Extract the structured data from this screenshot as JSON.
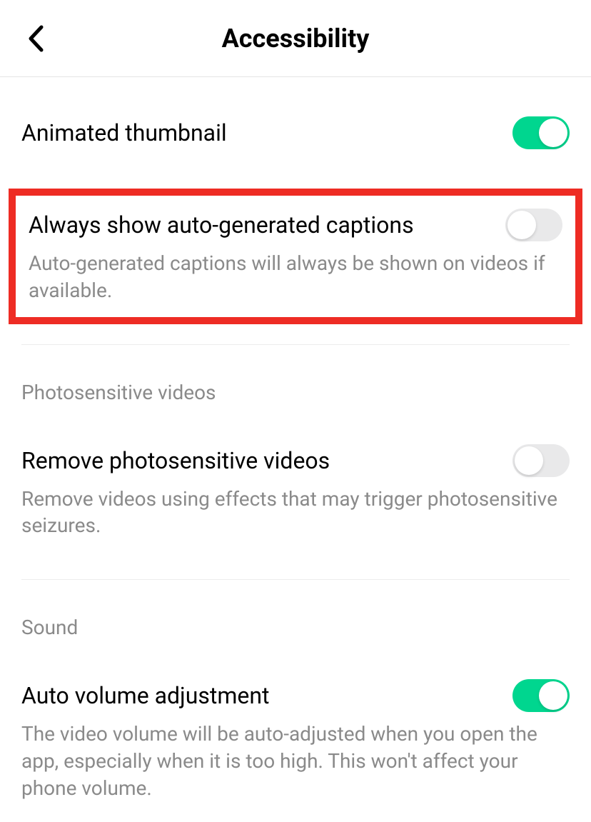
{
  "header": {
    "title": "Accessibility"
  },
  "settings": {
    "animated_thumbnail": {
      "title": "Animated thumbnail",
      "enabled": true
    },
    "auto_captions": {
      "title": "Always show auto-generated captions",
      "description": "Auto-generated captions will always be shown on videos if available.",
      "enabled": false
    },
    "photosensitive": {
      "section_label": "Photosensitive videos",
      "title": "Remove photosensitive videos",
      "description": "Remove videos using effects that may trigger photosensitive seizures.",
      "enabled": false
    },
    "sound": {
      "section_label": "Sound",
      "title": "Auto volume adjustment",
      "description": "The video volume will be auto-adjusted when you open the app, especially when it is too high. This won't affect your phone volume.",
      "enabled": true
    }
  }
}
